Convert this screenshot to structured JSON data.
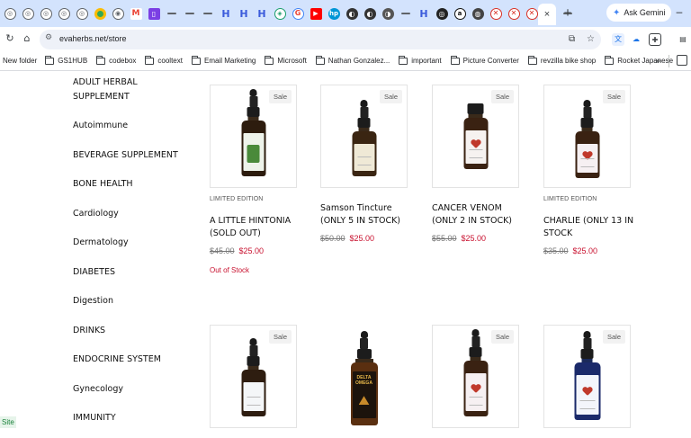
{
  "browser": {
    "active_tab_close": "×",
    "new_tab": "+",
    "ask_gemini": "Ask Gemini",
    "minimize": "–",
    "url": "evaherbs.net/store"
  },
  "bookmarks": [
    {
      "label": "New folder",
      "folder": false
    },
    {
      "label": "GS1HUB",
      "folder": true
    },
    {
      "label": "codebox",
      "folder": true
    },
    {
      "label": "cooltext",
      "folder": true
    },
    {
      "label": "Email Marketing",
      "folder": true
    },
    {
      "label": "Microsoft",
      "folder": true
    },
    {
      "label": "Nathan Gonzalez...",
      "folder": true
    },
    {
      "label": "important",
      "folder": true
    },
    {
      "label": "Picture Converter",
      "folder": true
    },
    {
      "label": "revzilla bike shop",
      "folder": true
    },
    {
      "label": "Rocket Japanese",
      "folder": true
    }
  ],
  "bookmarks_more": "»",
  "categories": [
    "ADULT HERBAL SUPPLEMENT",
    "Autoimmune",
    "BEVERAGE SUPPLEMENT",
    "BONE HEALTH",
    "Cardiology",
    "Dermatology",
    "DIABETES",
    "Digestion",
    "DRINKS",
    "ENDOCRINE SYSTEM",
    "Gynecology",
    "IMMUNITY"
  ],
  "site_badge": "Site",
  "products": [
    {
      "badge": "Sale",
      "ribbon": "LIMITED EDITION",
      "name": "A LITTLE HINTONIA (SOLD OUT)",
      "old_price": "$45.00",
      "price": "$25.00",
      "stock_note": "Out of Stock"
    },
    {
      "badge": "Sale",
      "ribbon": "",
      "name": "Samson Tincture (ONLY 5 IN STOCK)",
      "old_price": "$50.00",
      "price": "$25.00",
      "stock_note": ""
    },
    {
      "badge": "Sale",
      "ribbon": "",
      "name": "CANCER VENOM (ONLY 2 IN STOCK)",
      "old_price": "$55.00",
      "price": "$25.00",
      "stock_note": ""
    },
    {
      "badge": "Sale",
      "ribbon": "LIMITED EDITION",
      "name": "CHARLIE (ONLY 13 IN STOCK",
      "old_price": "$35.00",
      "price": "$25.00",
      "stock_note": ""
    },
    {
      "badge": "Sale",
      "ribbon": "",
      "name": "",
      "old_price": "",
      "price": "",
      "stock_note": ""
    },
    {
      "badge": "",
      "ribbon": "",
      "name": "",
      "old_price": "",
      "price": "",
      "stock_note": ""
    },
    {
      "badge": "Sale",
      "ribbon": "",
      "name": "",
      "old_price": "",
      "price": "",
      "stock_note": ""
    },
    {
      "badge": "Sale",
      "ribbon": "",
      "name": "",
      "old_price": "",
      "price": "",
      "stock_note": ""
    }
  ],
  "bottle_art": {
    "product_label_text": "DELTA OMEGA"
  },
  "colors": {
    "tabstrip": "#d3e3fd",
    "sale_price": "#c8102e",
    "omnibox": "#eef1f8"
  }
}
